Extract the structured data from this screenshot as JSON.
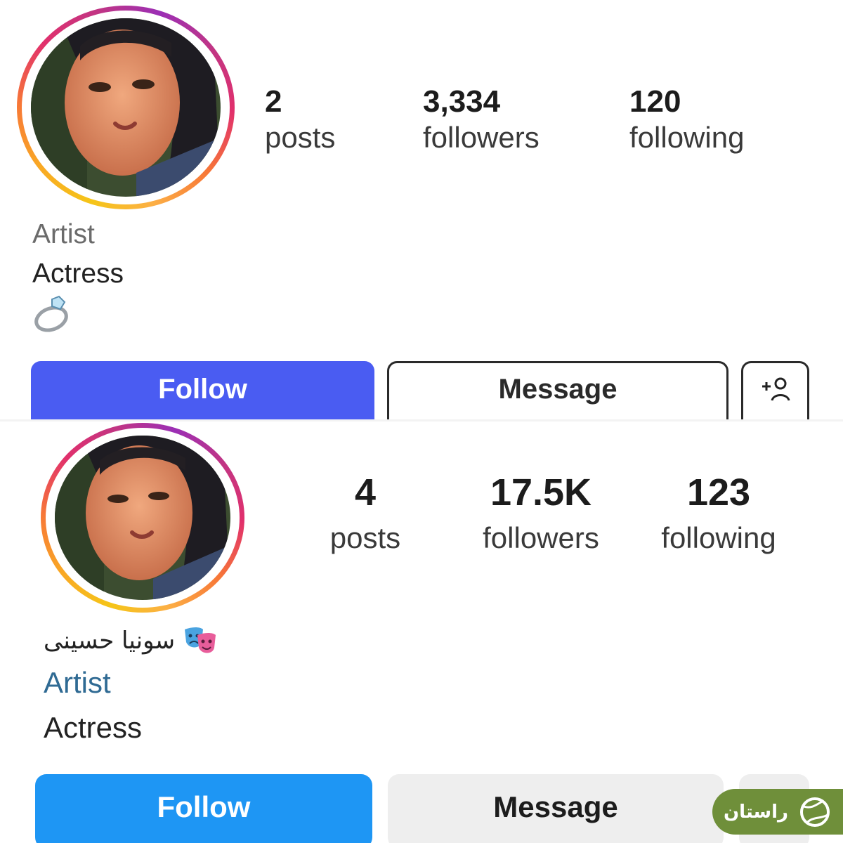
{
  "top": {
    "stats": [
      {
        "value": "2",
        "label": "posts"
      },
      {
        "value": "3,334",
        "label": "followers"
      },
      {
        "value": "120",
        "label": "following"
      }
    ],
    "category": "Artist",
    "bio": "Actress",
    "emoji": "💍",
    "follow_label": "Follow",
    "message_label": "Message",
    "add_user_icon": "add-person-icon",
    "colors": {
      "follow_bg": "#4a5cf2",
      "category_text": "#6b6b6b"
    }
  },
  "bottom": {
    "stats": [
      {
        "value": "4",
        "label": "posts"
      },
      {
        "value": "17.5K",
        "label": "followers"
      },
      {
        "value": "123",
        "label": "following"
      }
    ],
    "name": "سونیا حسینی",
    "name_emoji": "🎭",
    "category": "Artist",
    "bio": "Actress",
    "follow_label": "Follow",
    "message_label": "Message",
    "colors": {
      "follow_bg": "#1e96f4",
      "category_text": "#2f6a93"
    }
  },
  "watermark": {
    "text": "راستان",
    "icon": "tennis-ball-logo-icon",
    "color": "#6f8f3a"
  }
}
